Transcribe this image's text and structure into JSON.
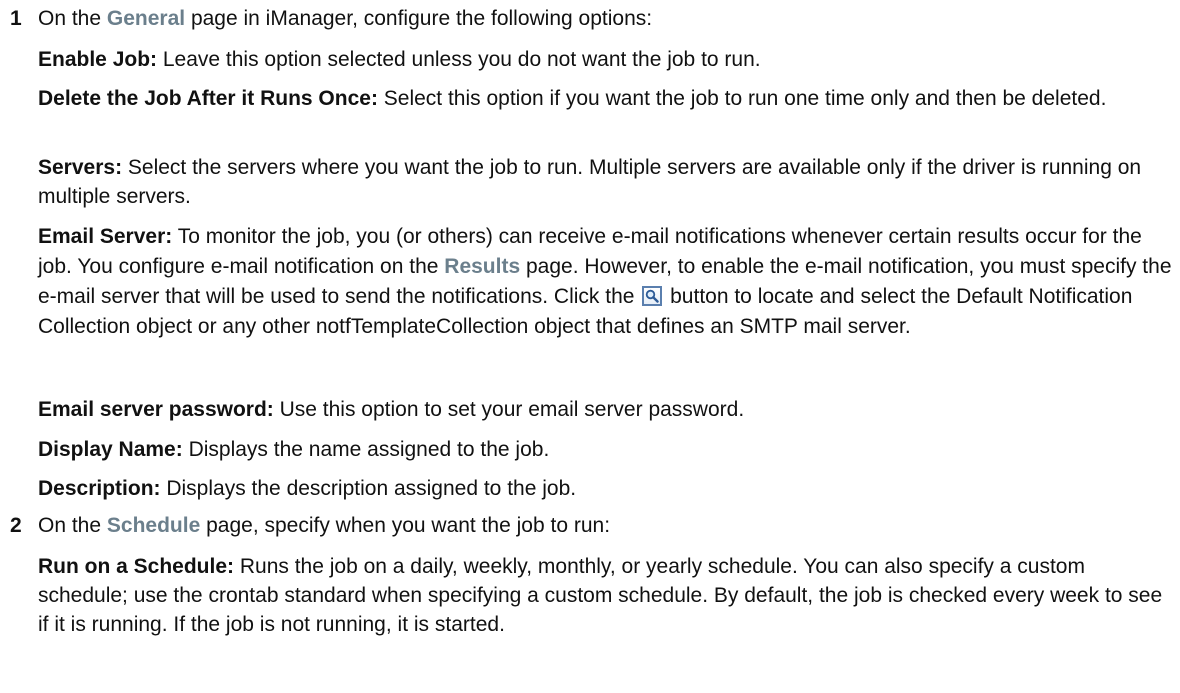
{
  "steps": [
    {
      "number": "1",
      "pre": "On the ",
      "ui": "General",
      "post": " page in iManager, configure the following options:",
      "options": [
        {
          "term": "Enable Job:",
          "text": " Leave this option selected unless you do not want the job to run."
        },
        {
          "term": "Delete the Job After it Runs Once:",
          "text": " Select this option if you want the job to run one time only and then be deleted."
        },
        {
          "term": "Servers:",
          "text": " Select the servers where you want the job to run. Multiple servers are available only if the driver is running on multiple servers."
        },
        {
          "term": "Email Server:",
          "text_a": " To monitor the job, you (or others) can receive e-mail notifications whenever certain results occur for the job. You configure e-mail notification on the ",
          "ui": "Results",
          "text_b": " page. However, to enable the e-mail notification, you must specify the e-mail server that will be used to send the notifications. Click the ",
          "icon": "search-icon",
          "text_c": " button to locate and select the Default Notification Collection object or any other notfTemplateCollection object that defines an SMTP mail server."
        },
        {
          "term": "Email server password:",
          "text": " Use this option to set your email server password."
        },
        {
          "term": "Display Name:",
          "text": " Displays the name assigned to the job."
        },
        {
          "term": "Description:",
          "text": " Displays the description assigned to the job."
        }
      ]
    },
    {
      "number": "2",
      "pre": "On the ",
      "ui": "Schedule",
      "post": " page, specify when you want the job to run:",
      "options": [
        {
          "term": "Run on a Schedule:",
          "text": " Runs the job on a daily, weekly, monthly, or yearly schedule. You can also specify a custom schedule; use the crontab standard when specifying a custom schedule. By default, the job is checked every week to see if it is running. If the job is not running, it is started."
        }
      ]
    }
  ],
  "colors": {
    "text": "#111111",
    "ui_reference": "#6b7f8c",
    "icon_border": "#5a7fae"
  }
}
